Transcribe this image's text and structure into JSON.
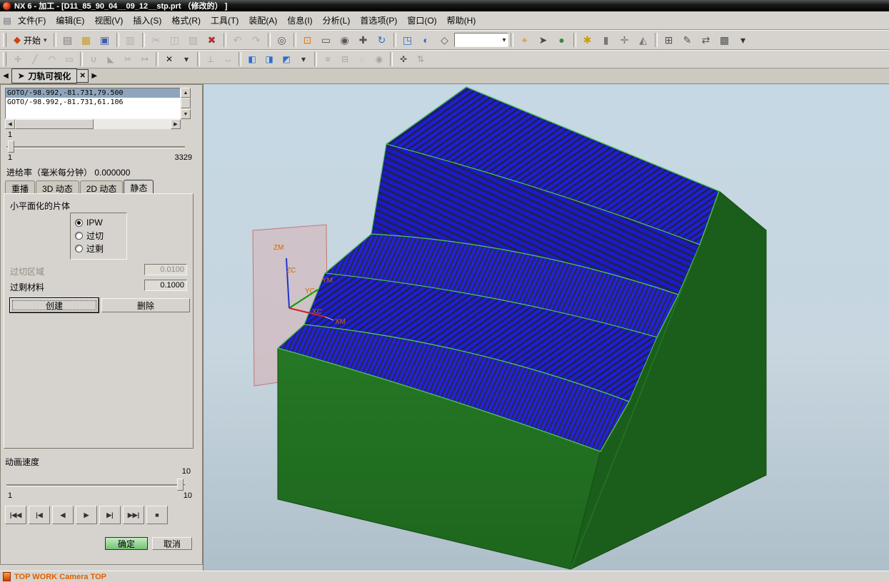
{
  "window": {
    "title": "NX 6 - 加工 - [D11_85_90_04__09_12__stp.prt （修改的） ]"
  },
  "menu": {
    "items": [
      "文件(F)",
      "编辑(E)",
      "视图(V)",
      "插入(S)",
      "格式(R)",
      "工具(T)",
      "装配(A)",
      "信息(I)",
      "分析(L)",
      "首选项(P)",
      "窗口(O)",
      "帮助(H)"
    ]
  },
  "toolbar_main": {
    "start_label": "开始",
    "icons": [
      {
        "name": "new-file-icon",
        "glyph": "▤",
        "color": "#7a7a7a"
      },
      {
        "name": "open-folder-icon",
        "glyph": "▦",
        "color": "#c89a20"
      },
      {
        "name": "save-icon",
        "glyph": "▣",
        "color": "#3a5fa8"
      },
      {
        "sep": true
      },
      {
        "name": "print-icon",
        "glyph": "▥",
        "color": "#777",
        "grayed": true
      },
      {
        "sep": true
      },
      {
        "name": "cut-icon",
        "glyph": "✂",
        "color": "#777",
        "grayed": true
      },
      {
        "name": "copy-icon",
        "glyph": "◫",
        "color": "#777",
        "grayed": true
      },
      {
        "name": "paste-icon",
        "glyph": "▨",
        "color": "#777",
        "grayed": true
      },
      {
        "name": "delete-icon",
        "glyph": "✖",
        "color": "#b03030"
      },
      {
        "sep": true
      },
      {
        "name": "undo-icon",
        "glyph": "↶",
        "color": "#777",
        "grayed": true
      },
      {
        "name": "redo-icon",
        "glyph": "↷",
        "color": "#777",
        "grayed": true
      },
      {
        "sep": true
      },
      {
        "name": "command-finder-icon",
        "glyph": "◎",
        "color": "#555"
      },
      {
        "sep": true
      },
      {
        "name": "fit-view-icon",
        "glyph": "⊡",
        "color": "#e07820"
      },
      {
        "name": "zoom-window-icon",
        "glyph": "▭",
        "color": "#555"
      },
      {
        "name": "zoom-icon",
        "glyph": "◉",
        "color": "#555"
      },
      {
        "name": "pan-icon",
        "glyph": "✚",
        "color": "#555"
      },
      {
        "name": "rotate-view-icon",
        "glyph": "↻",
        "color": "#2a6fd0"
      },
      {
        "sep": true
      },
      {
        "name": "trimetric-view-icon",
        "glyph": "◳",
        "color": "#2a6fd0"
      },
      {
        "name": "shaded-view-icon",
        "glyph": "◐",
        "color": "#2a6fd0"
      },
      {
        "name": "wireframe-view-icon",
        "glyph": "◇",
        "color": "#555"
      },
      {
        "name": "render-style-combo",
        "glyph": "▾",
        "combo": true
      },
      {
        "sep": true
      },
      {
        "name": "snap-point-icon",
        "glyph": "⌖",
        "color": "#d08020"
      },
      {
        "name": "selection-filter-icon",
        "glyph": "➤",
        "color": "#444"
      },
      {
        "name": "work-layer-icon",
        "glyph": "●",
        "color": "#3a8a3a"
      },
      {
        "sep": true
      },
      {
        "name": "key-icon",
        "glyph": "✱",
        "color": "#c8a000"
      },
      {
        "name": "lock-icon",
        "glyph": "▮",
        "color": "#777"
      },
      {
        "name": "measure-icon",
        "glyph": "✛",
        "color": "#777"
      },
      {
        "name": "analysis-icon",
        "glyph": "◭",
        "color": "#777"
      },
      {
        "sep": true
      },
      {
        "name": "datum-icon",
        "glyph": "⊞",
        "color": "#555"
      },
      {
        "name": "sketch-icon",
        "glyph": "✎",
        "color": "#555"
      },
      {
        "name": "move-icon",
        "glyph": "⇄",
        "color": "#555"
      },
      {
        "name": "pattern-icon",
        "glyph": "▩",
        "color": "#555"
      },
      {
        "name": "more-dropdown-icon",
        "glyph": "▾",
        "color": "#333"
      }
    ]
  },
  "toolbar_second": {
    "icons": [
      {
        "name": "point-icon",
        "glyph": "✛",
        "color": "#555",
        "grayed": true
      },
      {
        "name": "line-icon",
        "glyph": "╱",
        "color": "#555",
        "grayed": true
      },
      {
        "name": "arc-icon",
        "glyph": "◠",
        "color": "#555",
        "grayed": true
      },
      {
        "name": "rect-icon",
        "glyph": "▭",
        "color": "#555",
        "grayed": true
      },
      {
        "sep": true
      },
      {
        "name": "fillet-icon",
        "glyph": "∪",
        "color": "#555",
        "grayed": true
      },
      {
        "name": "chamfer-icon",
        "glyph": "◣",
        "color": "#555",
        "grayed": true
      },
      {
        "name": "trim-icon",
        "glyph": "✂",
        "color": "#555",
        "grayed": true
      },
      {
        "name": "extend-icon",
        "glyph": "↦",
        "color": "#555",
        "grayed": true
      },
      {
        "sep": true
      },
      {
        "name": "delete-small-icon",
        "glyph": "✕",
        "color": "#111"
      },
      {
        "name": "delete-dropdown-icon",
        "glyph": "▾",
        "color": "#333"
      },
      {
        "sep": true
      },
      {
        "name": "constraint-icon",
        "glyph": "⊥",
        "color": "#555",
        "grayed": true
      },
      {
        "name": "dimension-icon",
        "glyph": "↔",
        "color": "#555",
        "grayed": true
      },
      {
        "sep": true
      },
      {
        "name": "view-cube-front-icon",
        "glyph": "◧",
        "color": "#2a6fd0"
      },
      {
        "name": "view-cube-top-icon",
        "glyph": "◨",
        "color": "#2a6fd0"
      },
      {
        "name": "view-cube-iso-icon",
        "glyph": "◩",
        "color": "#2a6fd0"
      },
      {
        "name": "view-dropdown-icon",
        "glyph": "▾",
        "color": "#333"
      },
      {
        "sep": true
      },
      {
        "name": "layer-icon",
        "glyph": "≡",
        "color": "#555",
        "grayed": true
      },
      {
        "name": "group-icon",
        "glyph": "⊟",
        "color": "#555",
        "grayed": true
      },
      {
        "name": "hide-icon",
        "glyph": "◌",
        "color": "#555",
        "grayed": true
      },
      {
        "name": "show-icon",
        "glyph": "◉",
        "color": "#555",
        "grayed": true
      },
      {
        "sep": true
      },
      {
        "name": "wcs-icon",
        "glyph": "✜",
        "color": "#555"
      },
      {
        "name": "transform-icon",
        "glyph": "⇅",
        "color": "#555",
        "grayed": true
      }
    ]
  },
  "doc_tab": {
    "label": "刀轨可视化",
    "icon_glyph": "➤",
    "close_glyph": "✕",
    "prev_glyph": "◀",
    "next_glyph": "▶"
  },
  "dialog": {
    "goto_lines": [
      {
        "text": "GOTO/-98.992,-81.731,79.500",
        "selected": true
      },
      {
        "text": "GOTO/-98.992,-81.731,61.106",
        "selected": false
      }
    ],
    "scroll": {
      "up": "▲",
      "down": "▼",
      "left": "◀",
      "right": "▶"
    },
    "motion": {
      "current": "1",
      "min": "1",
      "max": "3329"
    },
    "feedrate_label": "进给率（毫米每分钟） 0.000000",
    "tabs": [
      "重播",
      "3D 动态",
      "2D 动态",
      "静态"
    ],
    "active_tab": "静态",
    "facet_section_label": "小平面化的片体",
    "radio_options": [
      "IPW",
      "过切",
      "过剩"
    ],
    "radio_selected": "IPW",
    "overcut_area": {
      "label": "过切区域",
      "value": "0.0100",
      "enabled": false
    },
    "excess_material": {
      "label": "过剩材料",
      "value": "0.1000",
      "enabled": true
    },
    "create_label": "创建",
    "delete_label": "删除",
    "anim_speed": {
      "label": "动画速度",
      "current": "10",
      "min": "1",
      "max": "10"
    },
    "playback": [
      "|◀◀",
      "|◀",
      "◀",
      "▶",
      "▶|",
      "▶▶|",
      "■"
    ],
    "ok_label": "确定",
    "cancel_label": "取消"
  },
  "viewport": {
    "axes": {
      "zm": "ZM",
      "zc": "ZC",
      "ym": "YM",
      "yc": "YC",
      "xc": "XC",
      "xm": "XM"
    }
  },
  "status_bar": {
    "text": "TOP WORK Camera TOP"
  },
  "colors": {
    "toolpath_blue": "#1e1ed2",
    "model_green_front": "#2b7f2b",
    "model_green_side": "#1b5e1b",
    "edge_green": "#4cc84c",
    "axis_label_orange": "#cc6a00",
    "ok_button_green": "#8fd08f",
    "viewport_top": "#c5d8e4",
    "viewport_bottom": "#afbfc9"
  }
}
